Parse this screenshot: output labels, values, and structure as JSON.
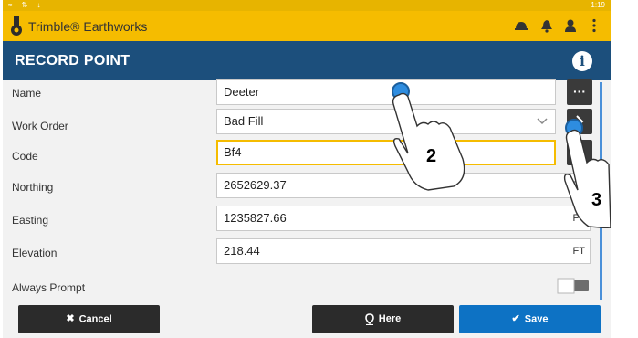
{
  "status": {
    "time": "1:19"
  },
  "app": {
    "title": "Trimble® Earthworks"
  },
  "page": {
    "title": "RECORD POINT",
    "info_label": "i"
  },
  "form": {
    "name": {
      "label": "Name",
      "value": "Deeter"
    },
    "work_order": {
      "label": "Work Order",
      "value": "Bad Fill"
    },
    "code": {
      "label": "Code",
      "value": "Bf4"
    },
    "northing": {
      "label": "Northing",
      "value": "2652629.37",
      "unit": "FT"
    },
    "easting": {
      "label": "Easting",
      "value": "1235827.66",
      "unit": "FT"
    },
    "elevation": {
      "label": "Elevation",
      "value": "218.44",
      "unit": "FT"
    },
    "always_prompt": {
      "label": "Always Prompt",
      "enabled": false
    }
  },
  "buttons": {
    "cancel": "Cancel",
    "here": "Here",
    "save": "Save",
    "more": "···"
  },
  "callouts": {
    "step_a": "2",
    "step_b": "3"
  },
  "colors": {
    "accent": "#f5bc00",
    "title_bar": "#1c4f7c",
    "save": "#0d72c4",
    "dark_button": "#2b2b2b"
  }
}
